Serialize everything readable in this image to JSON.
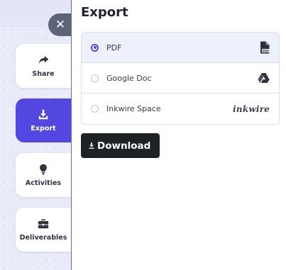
{
  "sidebar": {
    "close_glyph": "✕",
    "items": [
      {
        "label": "Share",
        "icon": "share-icon",
        "active": false
      },
      {
        "label": "Export",
        "icon": "export-icon",
        "active": true
      },
      {
        "label": "Activities",
        "icon": "lightbulb-icon",
        "active": false
      },
      {
        "label": "Deliverables",
        "icon": "briefcase-icon",
        "active": false
      }
    ]
  },
  "panel": {
    "title": "Export",
    "options": [
      {
        "label": "PDF",
        "selected": true,
        "icon": "pdf-file-icon"
      },
      {
        "label": "Google Doc",
        "selected": false,
        "icon": "google-drive-icon"
      },
      {
        "label": "Inkwire Space",
        "selected": false,
        "icon": "inkwire-logo",
        "logo_text": "inkwire"
      }
    ],
    "download_label": "Download",
    "download_icon": "download-icon"
  },
  "colors": {
    "accent": "#5446e0",
    "panel_border": "#6a5ef0",
    "download_bg": "#1f2224",
    "close_bg": "#5b6478",
    "canvas_bg": "#e9ebf9"
  }
}
